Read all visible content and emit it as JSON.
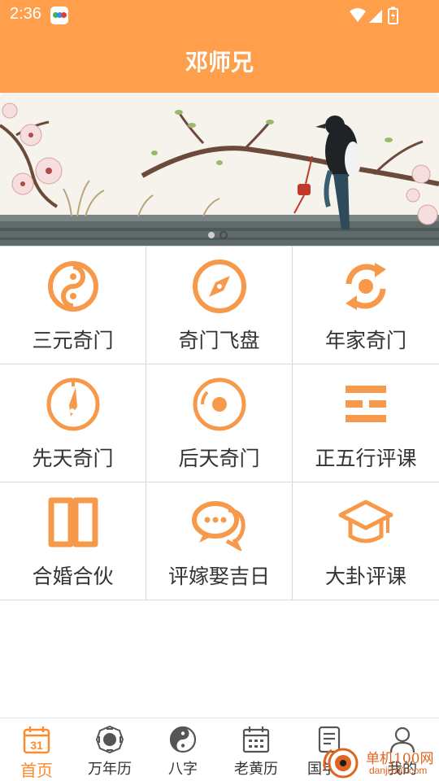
{
  "status_bar": {
    "time": "2:36"
  },
  "header": {
    "title": "邓师兄"
  },
  "grid": {
    "items": [
      {
        "label": "三元奇门",
        "icon": "yin-yang-icon"
      },
      {
        "label": "奇门飞盘",
        "icon": "compass-icon"
      },
      {
        "label": "年家奇门",
        "icon": "refresh-cycle-icon"
      },
      {
        "label": "先天奇门",
        "icon": "gauge-icon"
      },
      {
        "label": "后天奇门",
        "icon": "disc-icon"
      },
      {
        "label": "正五行评课",
        "icon": "trigram-icon"
      },
      {
        "label": "合婚合伙",
        "icon": "open-book-icon"
      },
      {
        "label": "评嫁娶吉日",
        "icon": "chat-bubbles-icon"
      },
      {
        "label": "大卦评课",
        "icon": "graduation-cap-icon"
      }
    ]
  },
  "bottom_nav": {
    "items": [
      {
        "label": "首页",
        "icon": "calendar-31-icon",
        "active": true
      },
      {
        "label": "万年历",
        "icon": "bagua-icon",
        "active": false
      },
      {
        "label": "八字",
        "icon": "taiji-icon",
        "active": false
      },
      {
        "label": "老黄历",
        "icon": "almanac-calendar-icon",
        "active": false
      },
      {
        "label": "国学院",
        "icon": "document-icon",
        "active": false
      },
      {
        "label": "我的",
        "icon": "user-icon",
        "active": false
      }
    ]
  },
  "calendar_icon_day": "31",
  "watermark": {
    "title": "单机100网",
    "url": "danji100.com"
  },
  "colors": {
    "accent": "#FF9F4C",
    "icon": "#F7994A",
    "active_text": "#FF8A2B"
  }
}
